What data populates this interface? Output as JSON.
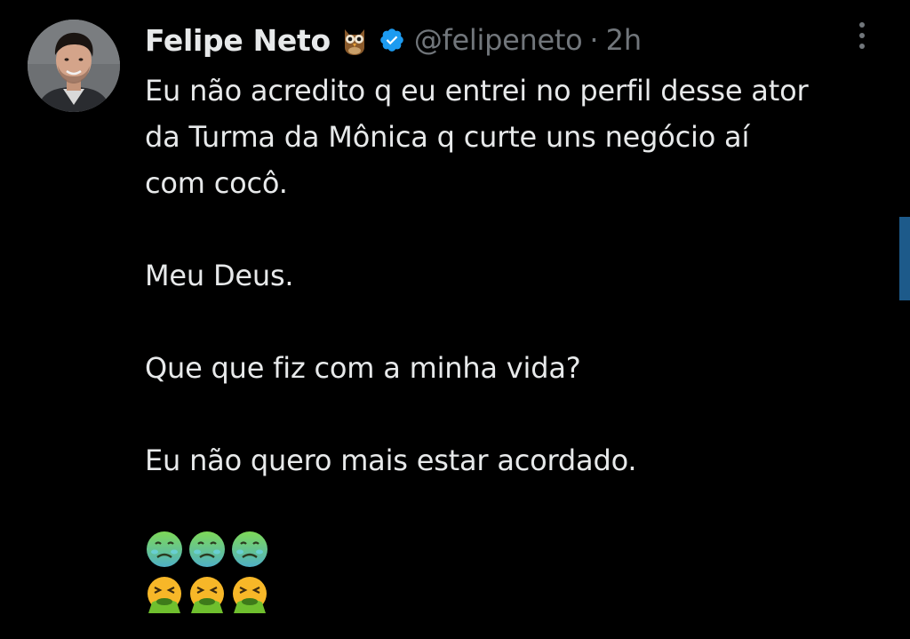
{
  "author": {
    "name": "Felipe Neto",
    "handle": "@felipeneto",
    "separator": "·",
    "time": "2h",
    "badge_icon": "owl-icon",
    "verified_icon": "verified-badge-icon",
    "verified_color": "#1d9bf0"
  },
  "tweet": {
    "line1": "Eu não acredito q eu entrei no perfil desse ator",
    "line2": "da Turma da Mônica q curte uns negócio aí",
    "line3": "com cocô.",
    "para2": "Meu Deus.",
    "para3": "Que que fiz com a minha vida?",
    "para4": "Eu não quero mais estar acordado."
  },
  "emojis": {
    "row1": [
      "nauseated-face-icon",
      "nauseated-face-icon",
      "nauseated-face-icon"
    ],
    "row2": [
      "vomiting-face-icon",
      "vomiting-face-icon",
      "vomiting-face-icon"
    ]
  },
  "colors": {
    "background": "#000000",
    "text": "#e7e9ea",
    "muted": "#71767b"
  }
}
